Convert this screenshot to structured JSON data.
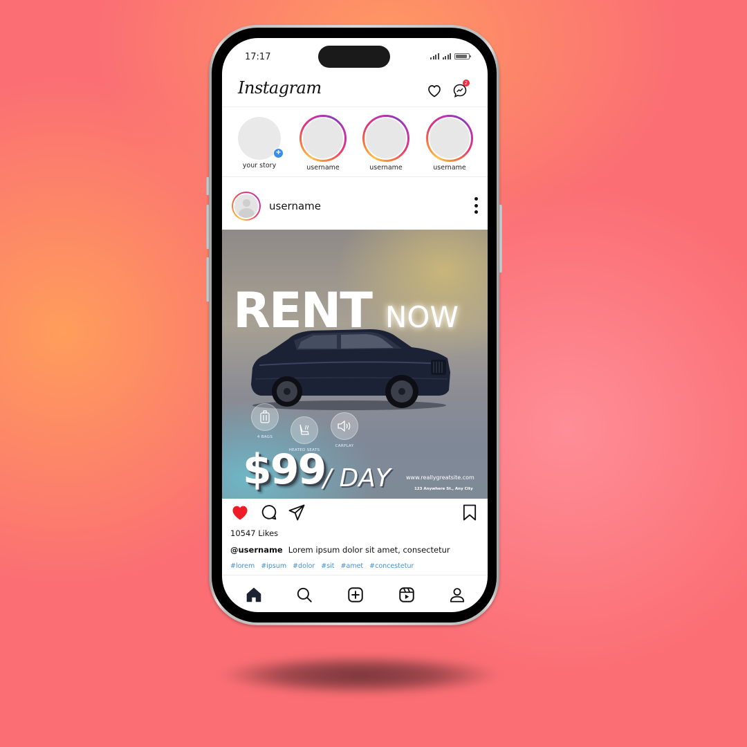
{
  "status_bar": {
    "time": "17:17",
    "battery_level": 0.9
  },
  "header": {
    "logo": "Instagram",
    "notification_badge": "2",
    "icons": [
      "heart-icon",
      "messenger-icon"
    ]
  },
  "stories": [
    {
      "label": "your story",
      "own": true
    },
    {
      "label": "username",
      "own": false
    },
    {
      "label": "username",
      "own": false
    },
    {
      "label": "username",
      "own": false
    }
  ],
  "post": {
    "username": "username",
    "image": {
      "headline": "RENT",
      "headline_suffix": "NOW",
      "features": [
        {
          "icon": "luggage-icon",
          "label": "4 BAGS"
        },
        {
          "icon": "heated-seat-icon",
          "label": "HEATED SEATS"
        },
        {
          "icon": "speaker-icon",
          "label": "CARPLAY"
        }
      ],
      "price": "$99",
      "per": "/ DAY",
      "website": "www.reallygreatsite.com",
      "address": "123 Anywhere St., Any City"
    },
    "liked": true,
    "likes": "10547 Likes",
    "caption_user": "@username",
    "caption_text": "Lorem ipsum dolor sit amet, consectetur",
    "hashtags": [
      "#lorem",
      "#ipsum",
      "#dolor",
      "#sit",
      "#amet",
      "#concestetur"
    ]
  },
  "colors": {
    "like_red": "#ee1c24",
    "hashtag_blue": "#4a90c8",
    "badge_red": "#ee2c3c",
    "story_add_blue": "#3a8dea",
    "background_coral": "#fb6f74",
    "background_orange": "#ffa05a"
  },
  "bottom_nav": [
    "home-icon",
    "search-icon",
    "create-icon",
    "reels-icon",
    "profile-icon"
  ]
}
